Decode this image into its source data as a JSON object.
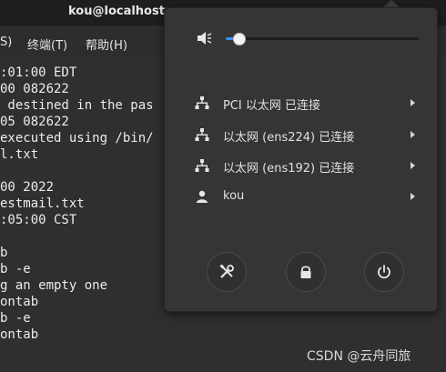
{
  "window": {
    "title": "kou@localhost:~"
  },
  "menubar": {
    "items": [
      "S)",
      "终端(T)",
      "帮助(H)"
    ]
  },
  "terminal": {
    "lines": [
      ":01:00 EDT",
      "00 082622",
      " destined in the pas",
      "05 082622",
      "executed using /bin/",
      "l.txt",
      "",
      "00 2022",
      "estmail.txt",
      ":05:00 CST",
      "",
      "b",
      "b -e",
      "g an empty one",
      "ontab",
      "b -e",
      "ontab"
    ]
  },
  "system_menu": {
    "volume": {
      "level": 0.07,
      "icon": "speaker-low-icon"
    },
    "network_items": [
      {
        "label": "PCI 以太网 已连接",
        "icon": "network-wired-icon"
      },
      {
        "label": "以太网 (ens224) 已连接",
        "icon": "network-wired-icon"
      },
      {
        "label": "以太网 (ens192) 已连接",
        "icon": "network-wired-icon"
      }
    ],
    "user": {
      "label": "kou",
      "icon": "user-icon"
    },
    "actions": [
      {
        "name": "settings",
        "icon": "settings-tools-icon"
      },
      {
        "name": "lock",
        "icon": "lock-icon"
      },
      {
        "name": "power",
        "icon": "power-icon"
      }
    ]
  },
  "watermark": {
    "text": "CSDN @云舟同旅"
  },
  "colors": {
    "accent": "#3f8ef0",
    "panel": "#353535",
    "terminal_bg": "#2f2f2f"
  }
}
